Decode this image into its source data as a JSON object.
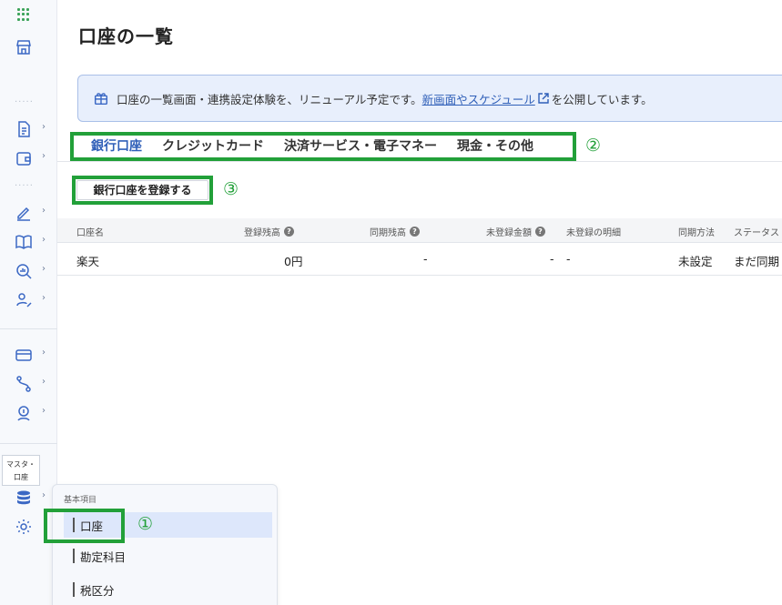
{
  "sidebar": {
    "tooltip_line1": "マスタ・",
    "tooltip_line2": "口座",
    "dots": "·····"
  },
  "page": {
    "title": "口座の一覧"
  },
  "banner": {
    "text_before": "口座の一覧画面・連携設定体験を、リニューアル予定です。",
    "link_text": "新画面やスケジュール",
    "text_after": "を公開しています。"
  },
  "tabs": [
    {
      "label": "銀行口座",
      "active": true
    },
    {
      "label": "クレジットカード",
      "active": false
    },
    {
      "label": "決済サービス・電子マネー",
      "active": false
    },
    {
      "label": "現金・その他",
      "active": false
    }
  ],
  "markers": {
    "m1": "①",
    "m2": "②",
    "m3": "③"
  },
  "register_button": "銀行口座を登録する",
  "table": {
    "headers": [
      "口座名",
      "登録残高",
      "同期残高",
      "未登録金額",
      "未登録の明細",
      "同期方法",
      "ステータス"
    ],
    "rows": [
      {
        "name": "楽天",
        "registered": "0円",
        "synced": "-",
        "unregistered_amount": "-",
        "unregistered_items": "-",
        "method": "未設定",
        "status": "まだ同期"
      }
    ]
  },
  "popup": {
    "title": "基本項目",
    "items": [
      "口座",
      "勘定科目",
      "税区分"
    ]
  },
  "colors": {
    "accent": "#2f5fb8",
    "highlight": "#22a039",
    "banner_bg": "#e8effc"
  }
}
